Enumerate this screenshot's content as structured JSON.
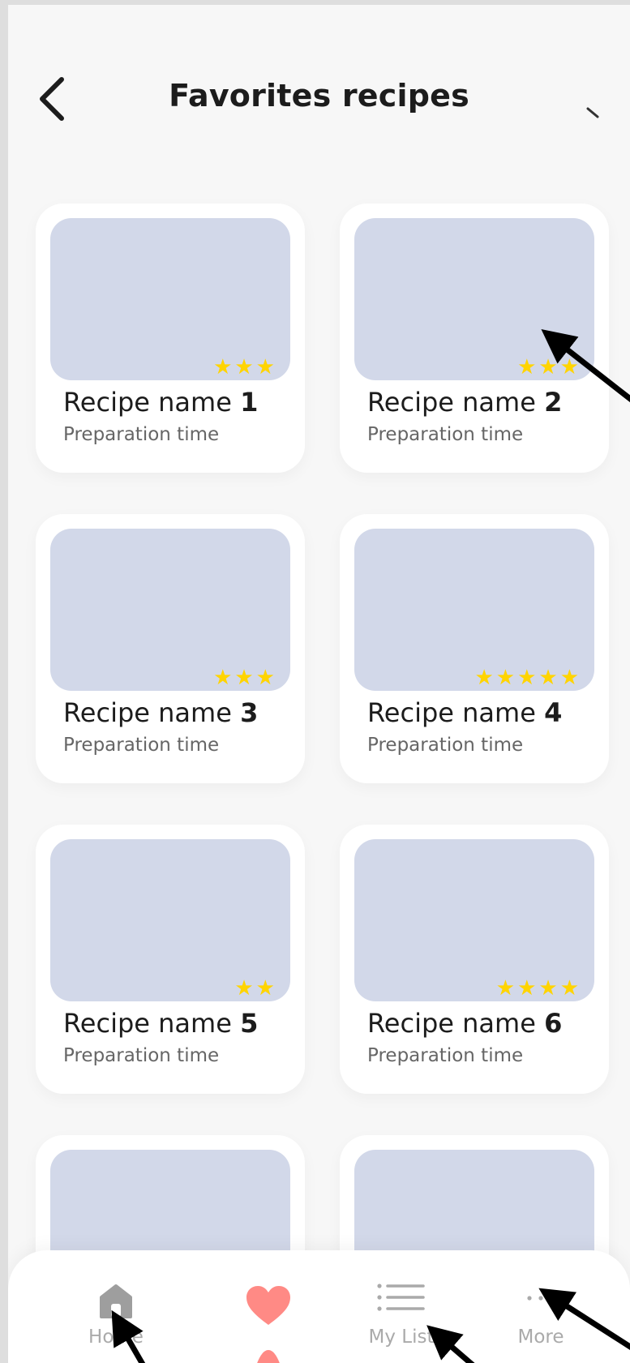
{
  "header": {
    "title": "Favorites recipes"
  },
  "recipes": [
    {
      "name": "Recipe name ",
      "number": "1",
      "prep": "Preparation time",
      "rating": 3
    },
    {
      "name": "Recipe name ",
      "number": "2",
      "prep": "Preparation time",
      "rating": 3
    },
    {
      "name": "Recipe name ",
      "number": "3",
      "prep": "Preparation time",
      "rating": 3
    },
    {
      "name": "Recipe name ",
      "number": "4",
      "prep": "Preparation time",
      "rating": 5
    },
    {
      "name": "Recipe name ",
      "number": "5",
      "prep": "Preparation time",
      "rating": 2
    },
    {
      "name": "Recipe name ",
      "number": "6",
      "prep": "Preparation time",
      "rating": 4
    }
  ],
  "nav": {
    "home": "Home",
    "favorites": "",
    "mylist": "My List",
    "more": "More"
  },
  "colors": {
    "card_image": "#d2d8e9",
    "star": "#ffd400",
    "heart": "#ff8a85",
    "nav_inactive": "#aaaaaa",
    "home_icon": "#9e9e9e"
  },
  "icons": {
    "back": "back-chevron-icon",
    "home": "home-icon",
    "favorites": "heart-icon",
    "mylist": "list-icon",
    "more": "more-dots-icon"
  }
}
